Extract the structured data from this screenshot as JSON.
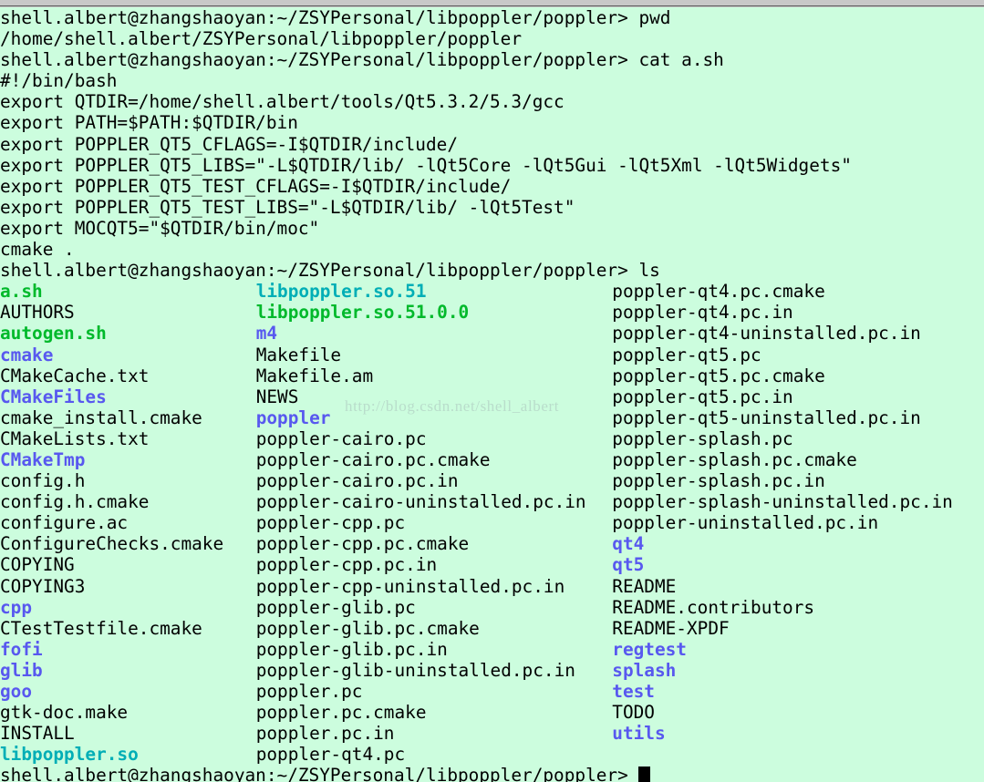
{
  "window": {
    "title": "shell.albert@zhangshaoyan: ~/ZSYPersonal/libpoppler/poppler",
    "background_color": "#ccfdde",
    "foreground_color": "#000000",
    "titlebar_color": "#c8c8c8"
  },
  "colors": {
    "default": "#000000",
    "directory": "#5858ef",
    "executable": "#00b92b",
    "symlink": "#00aeb6"
  },
  "watermark": {
    "text": "http://blog.csdn.net/shell_albert"
  },
  "prompt": {
    "text": "shell.albert@zhangshaoyan:~/ZSYPersonal/libpoppler/poppler>"
  },
  "session": {
    "commands": [
      {
        "prompt": "shell.albert@zhangshaoyan:~/ZSYPersonal/libpoppler/poppler>",
        "command": " pwd"
      },
      {
        "prompt": "shell.albert@zhangshaoyan:~/ZSYPersonal/libpoppler/poppler>",
        "command": " cat a.sh"
      },
      {
        "prompt": "shell.albert@zhangshaoyan:~/ZSYPersonal/libpoppler/poppler>",
        "command": " ls"
      }
    ],
    "pwd_output": "/home/shell.albert/ZSYPersonal/libpoppler/poppler",
    "cat_output": [
      "#!/bin/bash",
      "export QTDIR=/home/shell.albert/tools/Qt5.3.2/5.3/gcc",
      "export PATH=$PATH:$QTDIR/bin",
      "export POPPLER_QT5_CFLAGS=-I$QTDIR/include/",
      "export POPPLER_QT5_LIBS=\"-L$QTDIR/lib/ -lQt5Core -lQt5Gui -lQt5Xml -lQt5Widgets\"",
      "export POPPLER_QT5_TEST_CFLAGS=-I$QTDIR/include/",
      "export POPPLER_QT5_TEST_LIBS=\"-L$QTDIR/lib/ -lQt5Test\"",
      "export MOCQT5=\"$QTDIR/bin/moc\"",
      "cmake ."
    ]
  },
  "ls_output": {
    "column_char_offsets": [
      0,
      23,
      55
    ],
    "rows": [
      [
        {
          "name": "a.sh",
          "kind": "executable"
        },
        {
          "name": "libpoppler.so.51",
          "kind": "symlink"
        },
        {
          "name": "poppler-qt4.pc.cmake",
          "kind": "default"
        }
      ],
      [
        {
          "name": "AUTHORS",
          "kind": "default"
        },
        {
          "name": "libpoppler.so.51.0.0",
          "kind": "executable"
        },
        {
          "name": "poppler-qt4.pc.in",
          "kind": "default"
        }
      ],
      [
        {
          "name": "autogen.sh",
          "kind": "executable"
        },
        {
          "name": "m4",
          "kind": "directory"
        },
        {
          "name": "poppler-qt4-uninstalled.pc.in",
          "kind": "default"
        }
      ],
      [
        {
          "name": "cmake",
          "kind": "directory"
        },
        {
          "name": "Makefile",
          "kind": "default"
        },
        {
          "name": "poppler-qt5.pc",
          "kind": "default"
        }
      ],
      [
        {
          "name": "CMakeCache.txt",
          "kind": "default"
        },
        {
          "name": "Makefile.am",
          "kind": "default"
        },
        {
          "name": "poppler-qt5.pc.cmake",
          "kind": "default"
        }
      ],
      [
        {
          "name": "CMakeFiles",
          "kind": "directory"
        },
        {
          "name": "NEWS",
          "kind": "default"
        },
        {
          "name": "poppler-qt5.pc.in",
          "kind": "default"
        }
      ],
      [
        {
          "name": "cmake_install.cmake",
          "kind": "default"
        },
        {
          "name": "poppler",
          "kind": "directory"
        },
        {
          "name": "poppler-qt5-uninstalled.pc.in",
          "kind": "default"
        }
      ],
      [
        {
          "name": "CMakeLists.txt",
          "kind": "default"
        },
        {
          "name": "poppler-cairo.pc",
          "kind": "default"
        },
        {
          "name": "poppler-splash.pc",
          "kind": "default"
        }
      ],
      [
        {
          "name": "CMakeTmp",
          "kind": "directory"
        },
        {
          "name": "poppler-cairo.pc.cmake",
          "kind": "default"
        },
        {
          "name": "poppler-splash.pc.cmake",
          "kind": "default"
        }
      ],
      [
        {
          "name": "config.h",
          "kind": "default"
        },
        {
          "name": "poppler-cairo.pc.in",
          "kind": "default"
        },
        {
          "name": "poppler-splash.pc.in",
          "kind": "default"
        }
      ],
      [
        {
          "name": "config.h.cmake",
          "kind": "default"
        },
        {
          "name": "poppler-cairo-uninstalled.pc.in",
          "kind": "default"
        },
        {
          "name": "poppler-splash-uninstalled.pc.in",
          "kind": "default"
        }
      ],
      [
        {
          "name": "configure.ac",
          "kind": "default"
        },
        {
          "name": "poppler-cpp.pc",
          "kind": "default"
        },
        {
          "name": "poppler-uninstalled.pc.in",
          "kind": "default"
        }
      ],
      [
        {
          "name": "ConfigureChecks.cmake",
          "kind": "default"
        },
        {
          "name": "poppler-cpp.pc.cmake",
          "kind": "default"
        },
        {
          "name": "qt4",
          "kind": "directory"
        }
      ],
      [
        {
          "name": "COPYING",
          "kind": "default"
        },
        {
          "name": "poppler-cpp.pc.in",
          "kind": "default"
        },
        {
          "name": "qt5",
          "kind": "directory"
        }
      ],
      [
        {
          "name": "COPYING3",
          "kind": "default"
        },
        {
          "name": "poppler-cpp-uninstalled.pc.in",
          "kind": "default"
        },
        {
          "name": "README",
          "kind": "default"
        }
      ],
      [
        {
          "name": "cpp",
          "kind": "directory"
        },
        {
          "name": "poppler-glib.pc",
          "kind": "default"
        },
        {
          "name": "README.contributors",
          "kind": "default"
        }
      ],
      [
        {
          "name": "CTestTestfile.cmake",
          "kind": "default"
        },
        {
          "name": "poppler-glib.pc.cmake",
          "kind": "default"
        },
        {
          "name": "README-XPDF",
          "kind": "default"
        }
      ],
      [
        {
          "name": "fofi",
          "kind": "directory"
        },
        {
          "name": "poppler-glib.pc.in",
          "kind": "default"
        },
        {
          "name": "regtest",
          "kind": "directory"
        }
      ],
      [
        {
          "name": "glib",
          "kind": "directory"
        },
        {
          "name": "poppler-glib-uninstalled.pc.in",
          "kind": "default"
        },
        {
          "name": "splash",
          "kind": "directory"
        }
      ],
      [
        {
          "name": "goo",
          "kind": "directory"
        },
        {
          "name": "poppler.pc",
          "kind": "default"
        },
        {
          "name": "test",
          "kind": "directory"
        }
      ],
      [
        {
          "name": "gtk-doc.make",
          "kind": "default"
        },
        {
          "name": "poppler.pc.cmake",
          "kind": "default"
        },
        {
          "name": "TODO",
          "kind": "default"
        }
      ],
      [
        {
          "name": "INSTALL",
          "kind": "default"
        },
        {
          "name": "poppler.pc.in",
          "kind": "default"
        },
        {
          "name": "utils",
          "kind": "directory"
        }
      ],
      [
        {
          "name": "libpoppler.so",
          "kind": "symlink"
        },
        {
          "name": "poppler-qt4.pc",
          "kind": "default"
        },
        {
          "name": "",
          "kind": "default"
        }
      ]
    ]
  }
}
